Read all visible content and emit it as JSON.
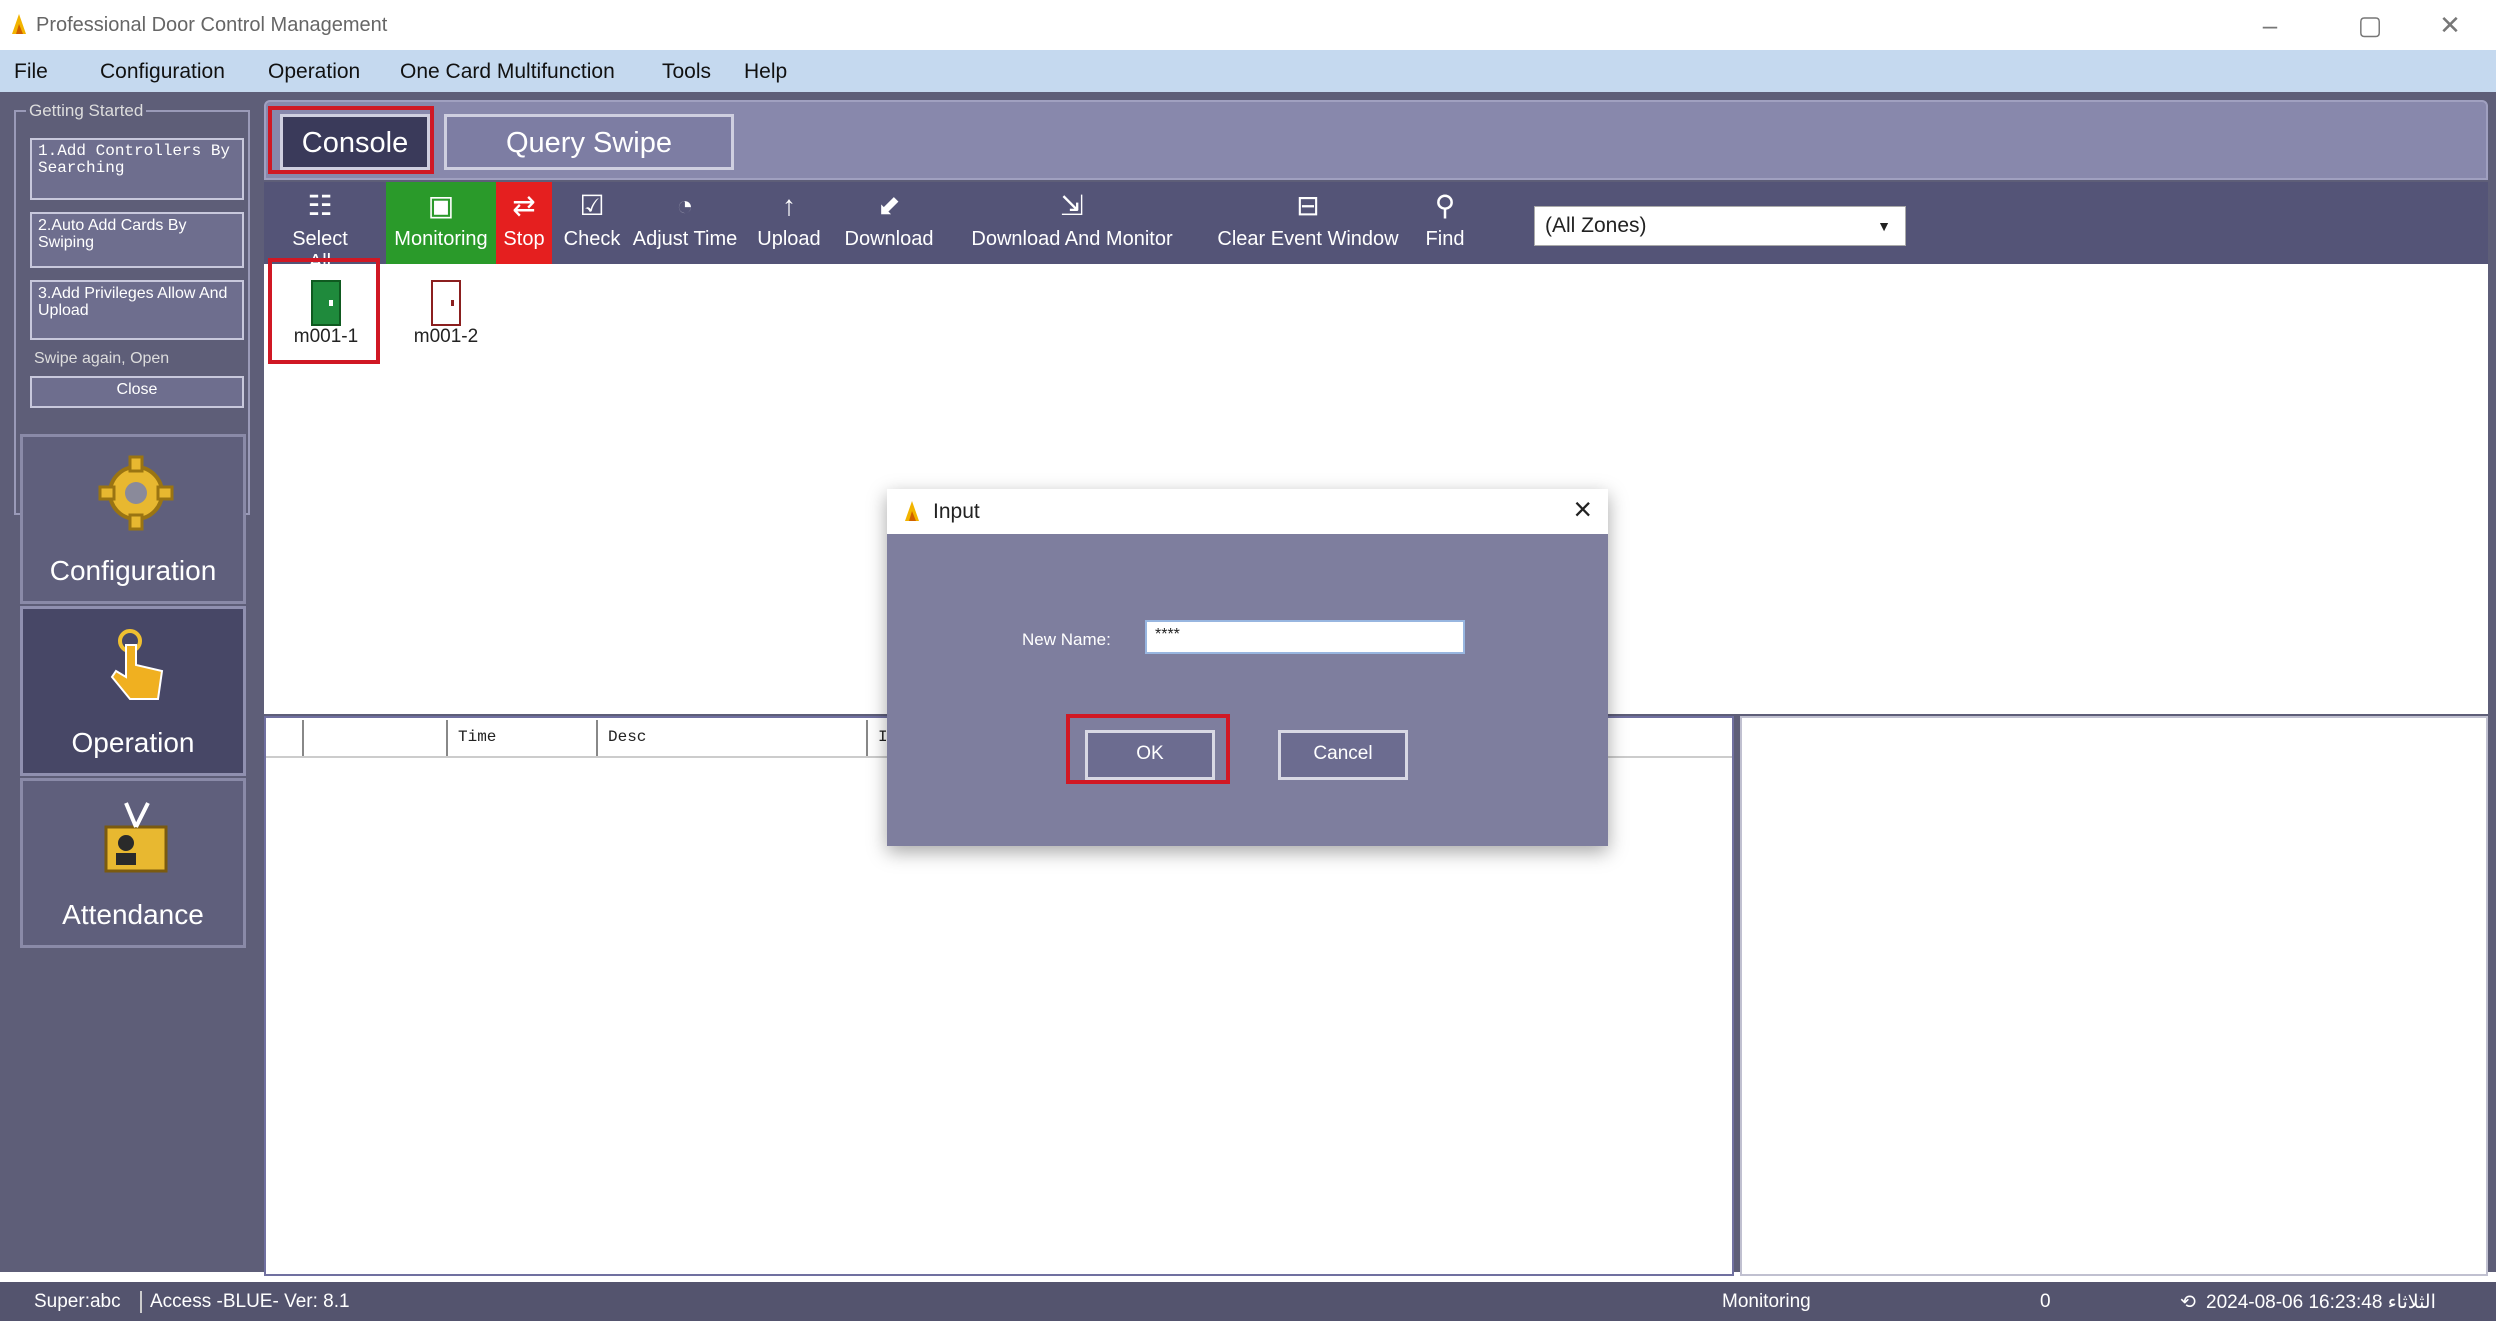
{
  "window": {
    "title": "Professional Door Control Management",
    "minimize": "–",
    "maximize": "▢",
    "close": "✕"
  },
  "menu": [
    "File",
    "Configuration",
    "Operation",
    "One Card Multifunction",
    "Tools",
    "Help"
  ],
  "getting_started": {
    "title": "Getting Started",
    "steps": [
      "1.Add Controllers By Searching",
      "2.Auto Add Cards By Swiping",
      "3.Add Privileges Allow And Upload"
    ],
    "note": "Swipe again, Open",
    "close": "Close"
  },
  "side_nav": [
    {
      "label": "Configuration",
      "icon": "gear-icon"
    },
    {
      "label": "Operation",
      "icon": "hand-pointer-icon"
    },
    {
      "label": "Attendance",
      "icon": "attendance-icon"
    }
  ],
  "tabs": [
    "Console",
    "Query Swipe Records"
  ],
  "toolbar": [
    {
      "label": "Select All",
      "glyph": "☷",
      "icon": "select-all-icon"
    },
    {
      "label": "Monitoring",
      "glyph": "▣",
      "icon": "monitor-icon"
    },
    {
      "label": "Stop",
      "glyph": "⇄",
      "icon": "stop-icon"
    },
    {
      "label": "Check",
      "glyph": "☑",
      "icon": "check-icon"
    },
    {
      "label": "Adjust Time",
      "glyph": "◔",
      "icon": "clock-icon"
    },
    {
      "label": "Upload",
      "glyph": "↑",
      "icon": "upload-icon"
    },
    {
      "label": "Download",
      "glyph": "⬋",
      "icon": "download-icon"
    },
    {
      "label": "Download And Monitor",
      "glyph": "⇲",
      "icon": "download-monitor-icon"
    },
    {
      "label": "Clear Event Window",
      "glyph": "⊟",
      "icon": "clear-icon"
    },
    {
      "label": "Find",
      "glyph": "⚲",
      "icon": "find-icon"
    }
  ],
  "zone_select": "(All Zones)",
  "doors": [
    {
      "name": "m001-1",
      "color": "#1f8a3c"
    },
    {
      "name": "m001-2",
      "color": "#8b1f1f"
    }
  ],
  "event_columns": [
    "",
    "Time",
    "Desc",
    "I"
  ],
  "dialog": {
    "title": "Input",
    "label": "New Name:",
    "value": "****",
    "ok": "OK",
    "cancel": "Cancel"
  },
  "status": {
    "user": "Super:abc",
    "mode": "Access -BLUE- Ver: 8.1",
    "state": "Monitoring",
    "count": "0",
    "datetime": "2024-08-06 16:23:48 الثلاثاء"
  },
  "colors": {
    "accent_red": "#d01824",
    "panel": "#5e5e78",
    "green": "#2a9a2a",
    "stop_red": "#e51f1f"
  }
}
